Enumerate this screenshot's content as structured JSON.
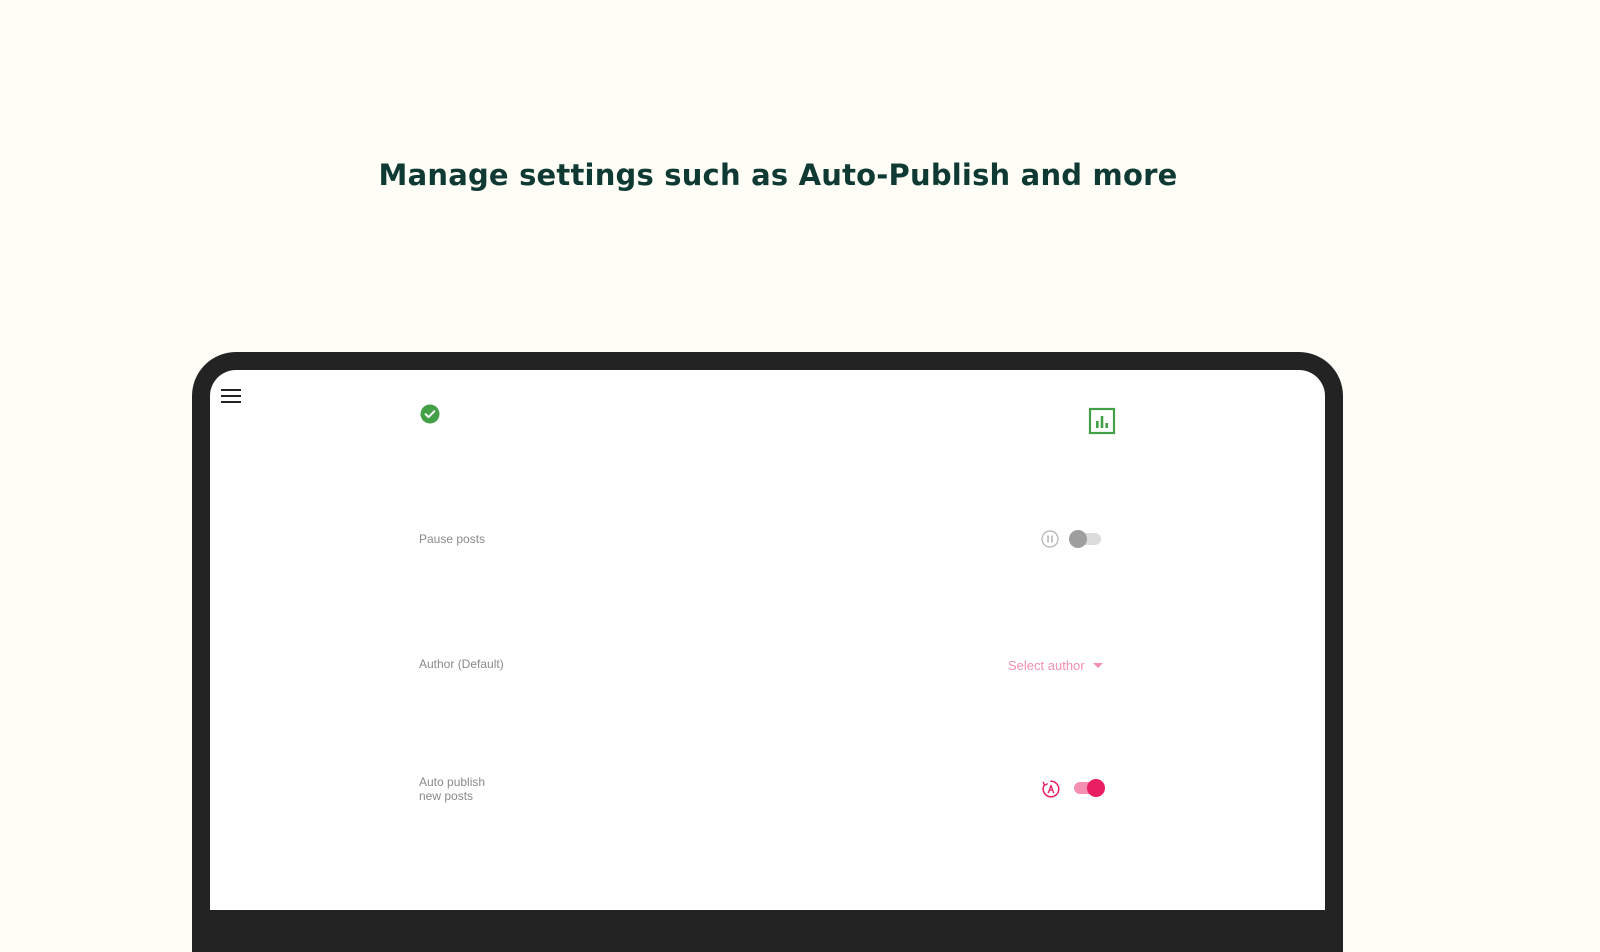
{
  "headline": "Manage settings such as Auto-Publish and more",
  "toolbar": {
    "menu_icon": "hamburger-menu-icon",
    "status_icon": "check-circle-icon",
    "analytics_icon": "bar-chart-icon"
  },
  "settings": {
    "pause_posts": {
      "label": "Pause posts",
      "icon": "pause-circle-icon",
      "enabled": false
    },
    "author": {
      "label": "Author (Default)",
      "placeholder": "Select author",
      "icon": "chevron-down-icon"
    },
    "auto_publish": {
      "label_line1": "Auto publish",
      "label_line2": "new posts",
      "icon": "auto-timer-icon",
      "enabled": true
    }
  },
  "colors": {
    "background": "#fefdf6",
    "headline": "#0e3a33",
    "device_frame": "#232323",
    "success_green": "#43a047",
    "accent_pink": "#e91e63",
    "accent_pink_light": "#f48fb1",
    "muted_gray": "#8a8a8a"
  }
}
